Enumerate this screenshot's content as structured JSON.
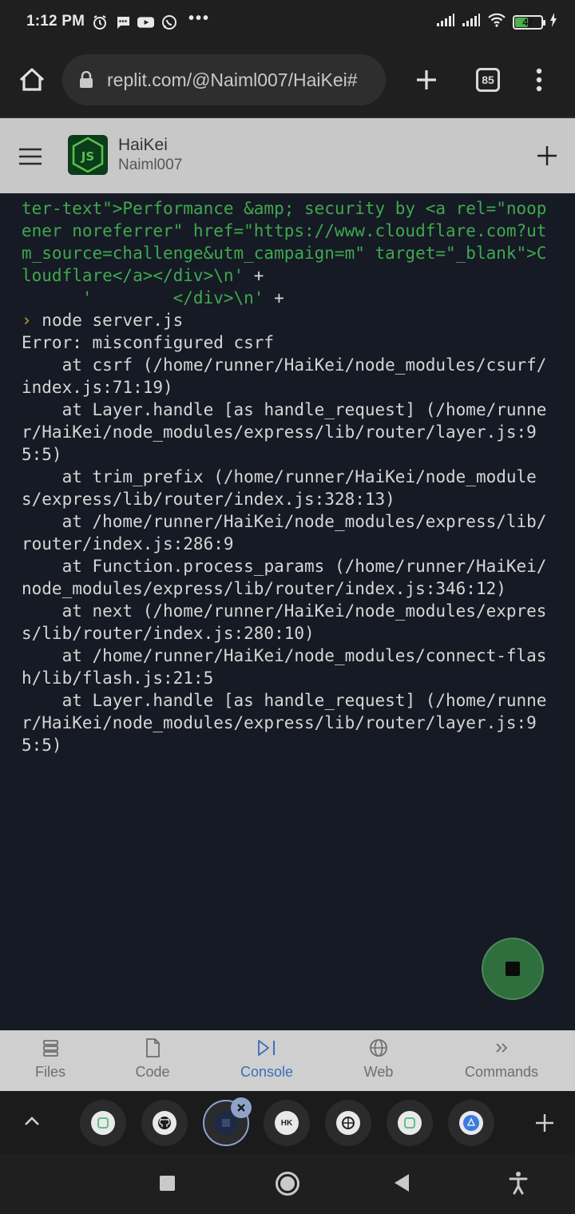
{
  "status_bar": {
    "time": "1:12 PM",
    "icons": [
      "alarm-icon",
      "message-icon",
      "youtube-icon",
      "whatsapp-icon"
    ],
    "overflow": "•••",
    "battery": "47"
  },
  "browser": {
    "url": "replit.com/@Naiml007/HaiKei#",
    "tab_count": "85"
  },
  "app_header": {
    "logo_text": "JS",
    "title": "HaiKei",
    "owner": "Naiml007"
  },
  "console": {
    "green_lines": [
      "ter-text\">Performance &amp; security by <a rel=\"noopener noreferrer\" href=\"https://www.cloudflare.com?utm_source=challenge&utm_campaign=m\" target=\"_blank\">Cloudflare</a></div>\\n'",
      "      '        </div>\\n'"
    ],
    "plus": " +",
    "prompt_symbol": "›",
    "command": " node server.js",
    "error_lines": [
      "Error: misconfigured csrf",
      "    at csrf (/home/runner/HaiKei/node_modules/csurf/index.js:71:19)",
      "    at Layer.handle [as handle_request] (/home/runner/HaiKei/node_modules/express/lib/router/layer.js:95:5)",
      "    at trim_prefix (/home/runner/HaiKei/node_modules/express/lib/router/index.js:328:13)",
      "    at /home/runner/HaiKei/node_modules/express/lib/router/index.js:286:9",
      "    at Function.process_params (/home/runner/HaiKei/node_modules/express/lib/router/index.js:346:12)",
      "    at next (/home/runner/HaiKei/node_modules/express/lib/router/index.js:280:10)",
      "    at /home/runner/HaiKei/node_modules/connect-flash/lib/flash.js:21:5",
      "    at Layer.handle [as handle_request] (/home/runner/HaiKei/node_modules/express/lib/router/layer.js:95:5)"
    ]
  },
  "bottom_tabs": [
    {
      "label": "Files",
      "icon": "files-icon",
      "active": false
    },
    {
      "label": "Code",
      "icon": "file-icon",
      "active": false
    },
    {
      "label": "Console",
      "icon": "console-icon",
      "active": true
    },
    {
      "label": "Web",
      "icon": "globe-icon",
      "active": false
    },
    {
      "label": "Commands",
      "icon": "chevrons-right-icon",
      "active": false
    }
  ],
  "extensions": [
    {
      "name": "replit-ext",
      "color": "#5ec08a"
    },
    {
      "name": "github-ext",
      "color": "#e6e6e6"
    },
    {
      "name": "selected-ext",
      "color": "#1e2a45"
    },
    {
      "name": "hk-ext",
      "label": "HK",
      "color": "#e6e6e6"
    },
    {
      "name": "browser-ext",
      "color": "#e6e6e6"
    },
    {
      "name": "replit-ext-2",
      "color": "#5ec08a"
    },
    {
      "name": "blue-ext",
      "color": "#3b7be0"
    }
  ],
  "colors": {
    "accent": "#3a6fb8",
    "console_bg": "#161a24",
    "console_green": "#3fa84f",
    "stop_button": "#2f6f3d"
  }
}
